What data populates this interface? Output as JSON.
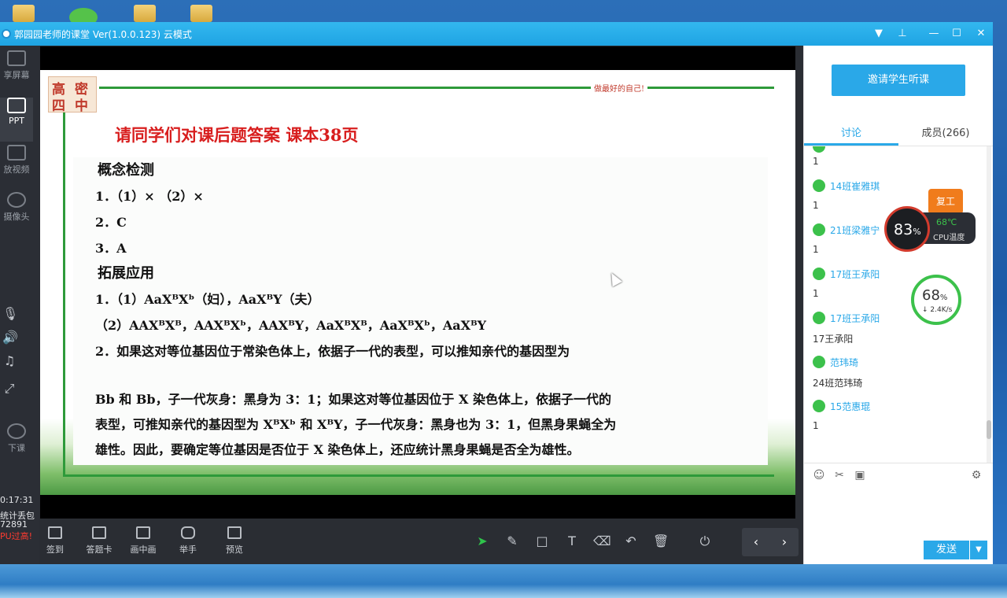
{
  "window": {
    "title": "郭园园老师的课堂 Ver(1.0.0.123)  云模式"
  },
  "left_sidebar": {
    "items": [
      {
        "label": "享屏幕",
        "icon": "share-screen-icon"
      },
      {
        "label": "PPT",
        "icon": "ppt-icon"
      },
      {
        "label": "放视频",
        "icon": "video-icon"
      },
      {
        "label": "摄像头",
        "icon": "camera-icon"
      }
    ],
    "end_class_label": "下课",
    "timer": "0:17:31",
    "stats": [
      "统计丢包",
      "72891"
    ],
    "cpu_warning": "PU过高!"
  },
  "slide": {
    "motto": "做最好的自己!",
    "logo_chars": [
      "高",
      "密",
      "四",
      "中"
    ],
    "heading": "请同学们对课后题答案  课本38页",
    "lines": [
      "概念检测",
      "1．（1）×       （2）×",
      "2．C",
      "3．A",
      "拓展应用",
      "1．（1）AaXᴮXᵇ（妇），AaXᴮY（夫）",
      "（2）AAXᴮXᴮ，AAXᴮXᵇ，AAXᴮY，AaXᴮXᴮ，AaXᴮXᵇ，AaXᴮY",
      "2．如果这对等位基因位于常染色体上，依据子一代的表型，可以推知亲代的基因型为",
      "Bb 和 Bb，子一代灰身：黑身为 3：1；如果这对等位基因位于 X 染色体上，依据子一代的",
      "表型，可推知亲代的基因型为 XᴮXᵇ 和 XᴮY，子一代灰身：黑身也为 3：1，但黑身果蝇全为",
      "雄性。因此，要确定等位基因是否位于 X 染色体上，还应统计黑身果蝇是否全为雄性。"
    ]
  },
  "toolbar": {
    "buttons": [
      "签到",
      "答题卡",
      "画中画",
      "举手",
      "预览"
    ]
  },
  "right_panel": {
    "invite_label": "邀请学生听课",
    "tabs": [
      "讨论",
      "成员(266)"
    ],
    "messages": [
      {
        "name": "",
        "text": "1"
      },
      {
        "name": "14班崔雅琪",
        "text": "1"
      },
      {
        "name": "21班梁雅宁",
        "text": "1"
      },
      {
        "name": "17班王承阳",
        "text": "1"
      },
      {
        "name": "17班王承阳",
        "text": "17王承阳"
      },
      {
        "name": "范玮琦",
        "text": "24班范玮琦"
      },
      {
        "name": "15范惠琨",
        "text": "1"
      }
    ],
    "send_label": "发送"
  },
  "overlay": {
    "cpu_percent": "83",
    "cpu_temp": "68℃",
    "cpu_temp_label": "CPU温度",
    "gift_label": "复工",
    "net_percent": "68",
    "net_speed": "2.4K/s"
  }
}
